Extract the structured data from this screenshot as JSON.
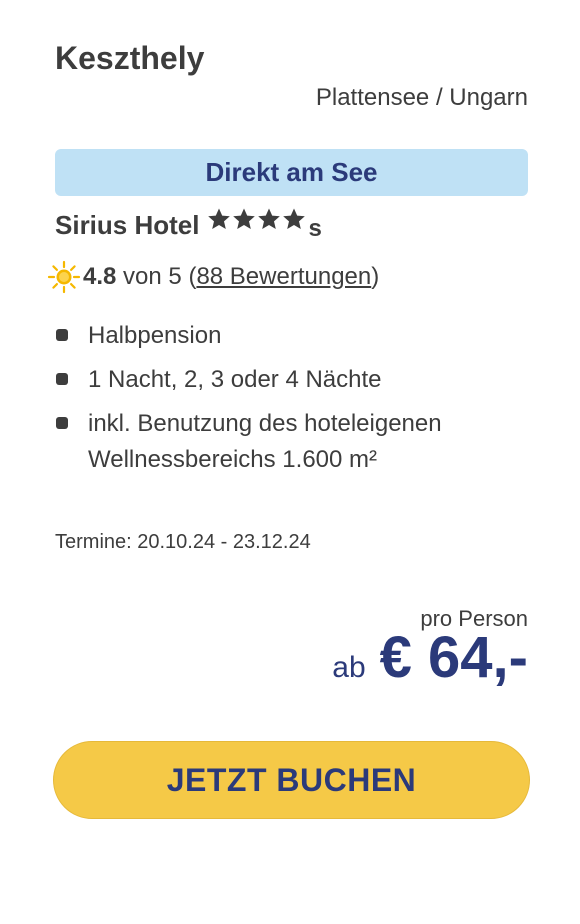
{
  "offer": {
    "city": "Keszthely",
    "region": "Plattensee / Ungarn",
    "badge": "Direkt am See",
    "hotel_name": "Sirius Hotel",
    "stars": 4,
    "stars_suffix": "s",
    "rating": {
      "score": "4.8",
      "of_text": "von 5",
      "open_paren": "(",
      "reviews_link": "88 Bewertungen",
      "close_paren": ")",
      "icon": "sun-icon"
    },
    "features": [
      "Halbpension",
      "1 Nacht, 2, 3 oder 4 Nächte",
      "inkl. Benutzung des hoteleigenen Wellnessbereichs 1.600 m²"
    ],
    "dates": "Termine: 20.10.24 - 23.12.24",
    "price": {
      "per_person": "pro Person",
      "prefix": "ab",
      "amount": "€ 64,-"
    },
    "cta_label": "JETZT BUCHEN"
  },
  "colors": {
    "text": "#3d3d3d",
    "brand_blue": "#2b3a7a",
    "badge_bg": "#bfe1f5",
    "cta_bg": "#f5c947",
    "sun": "#f5b800"
  }
}
